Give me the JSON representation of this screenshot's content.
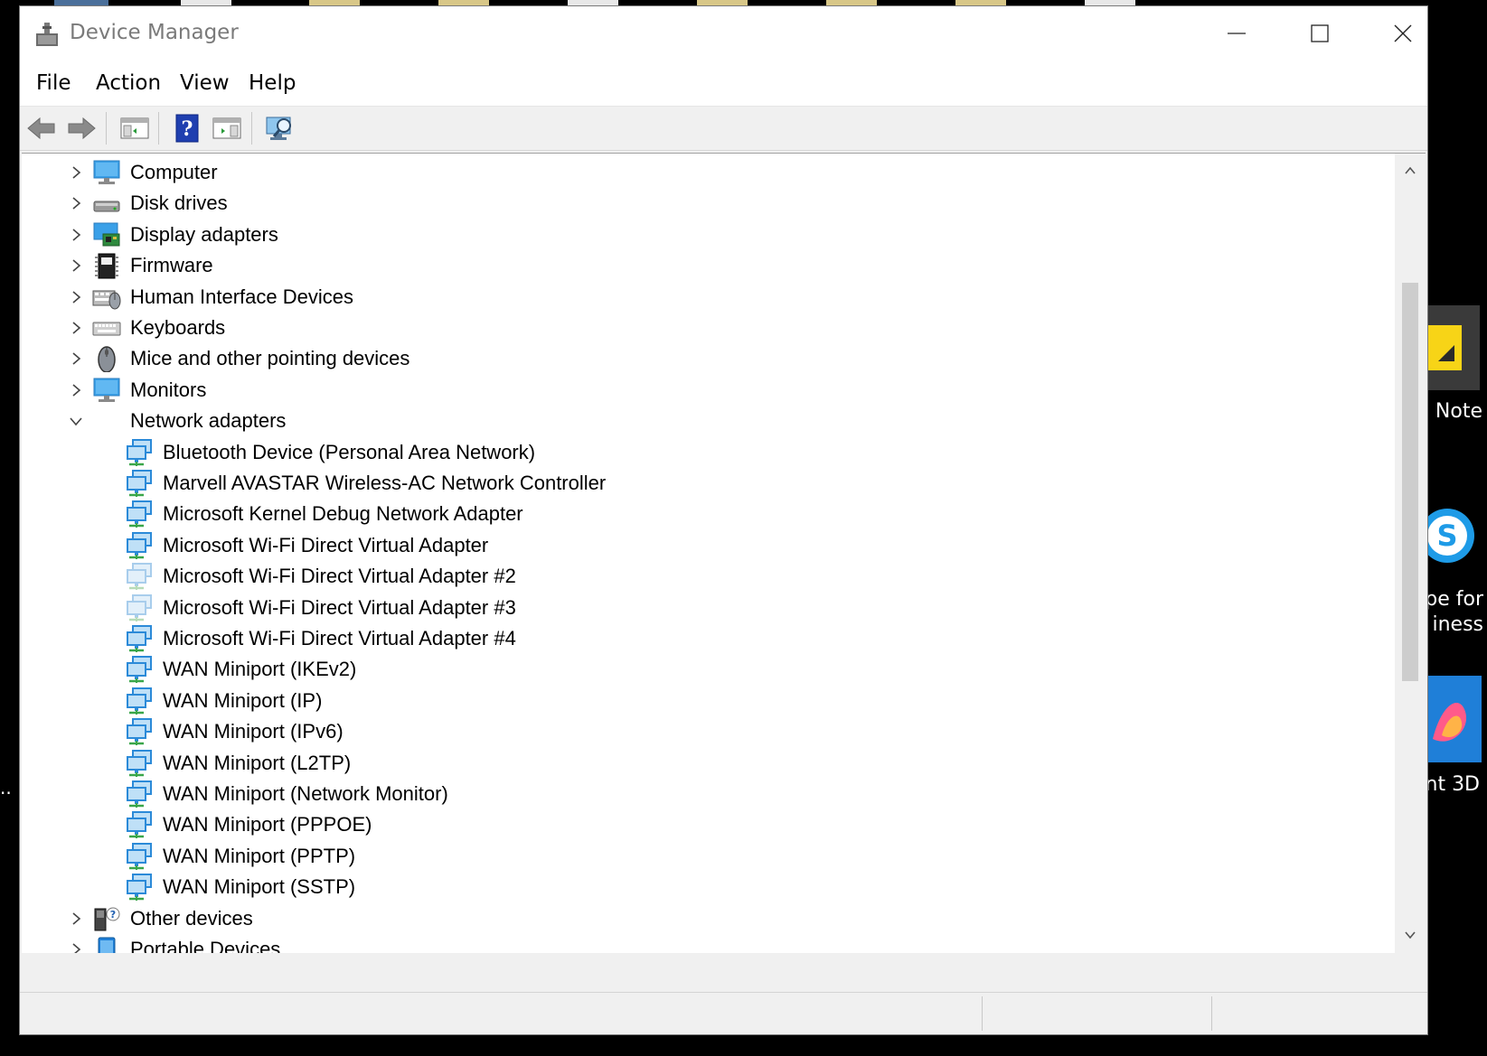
{
  "window": {
    "title": "Device Manager"
  },
  "menu": {
    "file": "File",
    "action": "Action",
    "view": "View",
    "help": "Help"
  },
  "toolbar": {
    "buttons": [
      {
        "name": "back-arrow-icon"
      },
      {
        "name": "forward-arrow-icon"
      },
      {
        "name": "show-hide-console-tree-icon"
      },
      {
        "name": "help-icon"
      },
      {
        "name": "properties-pane-icon"
      },
      {
        "name": "scan-hardware-changes-icon"
      }
    ]
  },
  "tree": {
    "categories": [
      {
        "label": "Computer",
        "icon": "computer-icon",
        "expanded": false
      },
      {
        "label": "Disk drives",
        "icon": "disk-drive-icon",
        "expanded": false
      },
      {
        "label": "Display adapters",
        "icon": "display-adapter-icon",
        "expanded": false
      },
      {
        "label": "Firmware",
        "icon": "firmware-chip-icon",
        "expanded": false
      },
      {
        "label": "Human Interface Devices",
        "icon": "hid-icon",
        "expanded": false
      },
      {
        "label": "Keyboards",
        "icon": "keyboard-icon",
        "expanded": false
      },
      {
        "label": "Mice and other pointing devices",
        "icon": "mouse-icon",
        "expanded": false
      },
      {
        "label": "Monitors",
        "icon": "monitor-icon",
        "expanded": false
      },
      {
        "label": "Network adapters",
        "icon": "network-adapter-icon",
        "expanded": true
      }
    ],
    "network_adapters": [
      {
        "label": "Bluetooth Device (Personal Area Network)",
        "dimmed": false
      },
      {
        "label": "Marvell AVASTAR Wireless-AC Network Controller",
        "dimmed": false
      },
      {
        "label": "Microsoft Kernel Debug Network Adapter",
        "dimmed": false
      },
      {
        "label": "Microsoft Wi-Fi Direct Virtual Adapter",
        "dimmed": false
      },
      {
        "label": "Microsoft Wi-Fi Direct Virtual Adapter #2",
        "dimmed": true
      },
      {
        "label": "Microsoft Wi-Fi Direct Virtual Adapter #3",
        "dimmed": true
      },
      {
        "label": "Microsoft Wi-Fi Direct Virtual Adapter #4",
        "dimmed": false
      },
      {
        "label": "WAN Miniport (IKEv2)",
        "dimmed": false
      },
      {
        "label": "WAN Miniport (IP)",
        "dimmed": false
      },
      {
        "label": "WAN Miniport (IPv6)",
        "dimmed": false
      },
      {
        "label": "WAN Miniport (L2TP)",
        "dimmed": false
      },
      {
        "label": "WAN Miniport (Network Monitor)",
        "dimmed": false
      },
      {
        "label": "WAN Miniport (PPPOE)",
        "dimmed": false
      },
      {
        "label": "WAN Miniport (PPTP)",
        "dimmed": false
      },
      {
        "label": "WAN Miniport (SSTP)",
        "dimmed": false
      }
    ],
    "after": [
      {
        "label": "Other devices",
        "icon": "other-devices-icon"
      },
      {
        "label": "Portable Devices",
        "icon": "portable-device-icon"
      }
    ]
  },
  "desktop": {
    "labels": [
      "Note",
      "pe for",
      "iness",
      "nt 3D"
    ]
  },
  "colors": {
    "network_blue": "#2b8ad8",
    "network_blue_dim": "#a8cdec",
    "window_bg": "#f0f0f0"
  }
}
